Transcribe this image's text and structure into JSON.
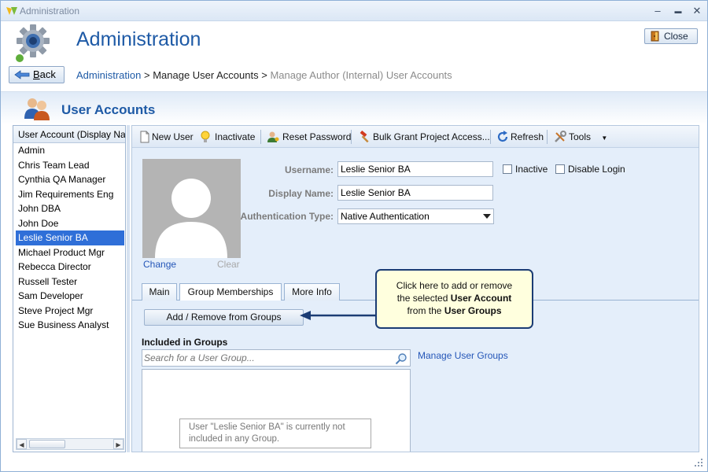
{
  "window": {
    "title": "Administration",
    "minimize_glyph": "–",
    "maximize_glyph": "▬",
    "close_glyph": "✕"
  },
  "header": {
    "page_title": "Administration",
    "close_label": "Close",
    "back_label_rest": "ack",
    "back_label_accel": "B",
    "breadcrumb": {
      "link": "Administration",
      "sep": " > ",
      "middle": "Manage User Accounts",
      "sep2": " > ",
      "current": "Manage Author (Internal) User Accounts"
    }
  },
  "section": {
    "title": "User Accounts"
  },
  "user_list": {
    "header": "User Account (Display Name)",
    "items": [
      "Admin",
      "Chris Team Lead",
      "Cynthia QA Manager",
      "Jim Requirements Eng",
      "John DBA",
      "John Doe",
      "Leslie Senior BA",
      "Michael Product Mgr",
      "Rebecca Director",
      "Russell Tester",
      "Sam Developer",
      "Steve Project Mgr",
      "Sue Business Analyst"
    ],
    "selected_index": 6
  },
  "toolbar": {
    "new_user": "New User",
    "inactivate": "Inactivate",
    "reset_password": "Reset Password",
    "bulk_grant": "Bulk Grant Project Access...",
    "refresh": "Refresh",
    "tools": "Tools"
  },
  "details": {
    "change_link": "Change",
    "clear_link": "Clear",
    "username_label": "Username:",
    "username_value": "Leslie Senior BA",
    "display_name_label": "Display Name:",
    "display_name_value": "Leslie Senior BA",
    "auth_type_label": "Authentication Type:",
    "auth_type_value": "Native Authentication",
    "inactive_label": "Inactive",
    "disable_login_label": "Disable Login"
  },
  "tabs": {
    "main": "Main",
    "group_memberships": "Group Memberships",
    "more_info": "More Info",
    "active": "group_memberships"
  },
  "groups": {
    "add_remove_button": "Add / Remove from Groups",
    "included_label": "Included in Groups",
    "search_placeholder": "Search for a User Group...",
    "manage_link": "Manage User Groups",
    "empty_line1": "User \"Leslie Senior BA\" is currently not",
    "empty_line2": "included in any Group."
  },
  "callout": {
    "line1": "Click here to add or remove",
    "line2_prefix": "the selected ",
    "line2_bold": "User Account",
    "line3_prefix": "from the ",
    "line3_bold": "User Groups"
  },
  "colors": {
    "accent": "#1e5aa6",
    "selection": "#2f6fd8",
    "callout_border": "#1b3c74",
    "callout_fill": "#ffffde"
  }
}
